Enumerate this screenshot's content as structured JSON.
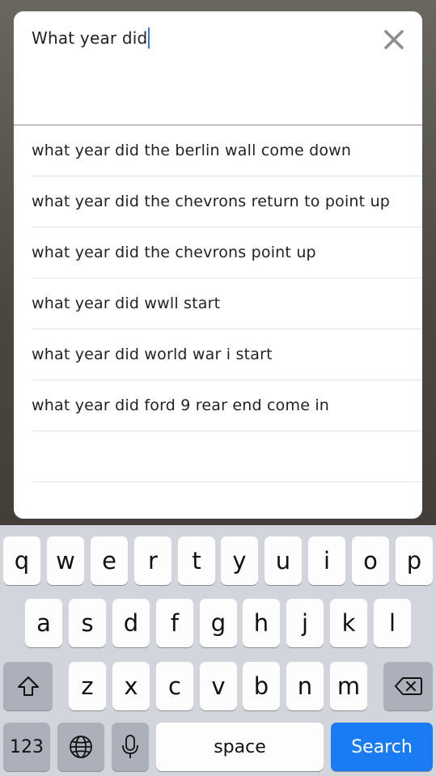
{
  "search": {
    "query": "What year did"
  },
  "suggestions": [
    "what year did the berlin wall come down",
    "what year did the chevrons return to point up",
    "what year did the chevrons point up",
    "what year did wwll start",
    "what year did world war i start",
    "what year did ford 9 rear end come in",
    ""
  ],
  "keyboard": {
    "row1": [
      "q",
      "w",
      "e",
      "r",
      "t",
      "y",
      "u",
      "i",
      "o",
      "p"
    ],
    "row2": [
      "a",
      "s",
      "d",
      "f",
      "g",
      "h",
      "j",
      "k",
      "l"
    ],
    "row3": [
      "z",
      "x",
      "c",
      "v",
      "b",
      "n",
      "m"
    ],
    "numbers_label": "123",
    "space_label": "space",
    "search_label": "Search"
  },
  "colors": {
    "caret": "#3478f6",
    "search_key": "#1a7cf5",
    "keyboard_bg": "#d2d5db"
  },
  "icons": [
    "close-icon",
    "shift-icon",
    "backspace-icon",
    "globe-icon",
    "microphone-icon"
  ]
}
